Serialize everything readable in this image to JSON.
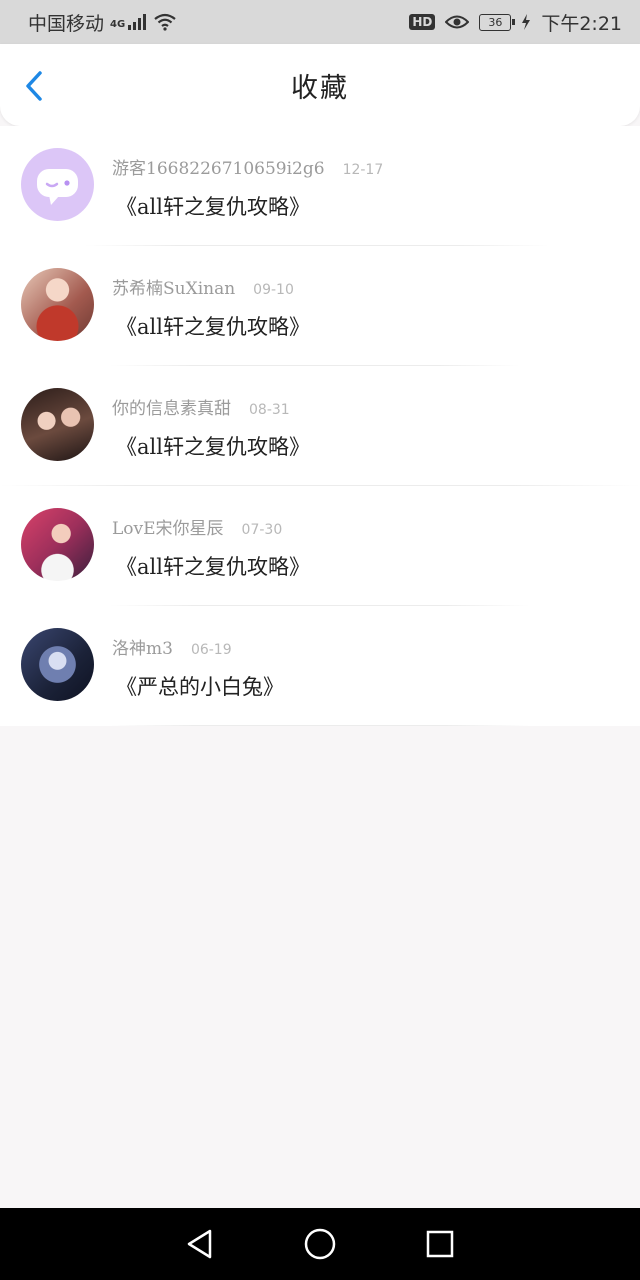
{
  "status_bar": {
    "carrier": "中国移动",
    "network": "4G",
    "hd_label": "HD",
    "battery": "36",
    "time": "下午2:21"
  },
  "header": {
    "title": "收藏"
  },
  "favorites": [
    {
      "username": "游客1668226710659i2g6",
      "date": "12-17",
      "title": "《all轩之复仇攻略》",
      "avatar_icon": "chat-bubble-icon"
    },
    {
      "username": "苏希楠SuXinan",
      "date": "09-10",
      "title": "《all轩之复仇攻略》",
      "avatar_icon": "user-photo"
    },
    {
      "username": "你的信息素真甜",
      "date": "08-31",
      "title": "《all轩之复仇攻略》",
      "avatar_icon": "user-photo"
    },
    {
      "username": "LovE宋你星辰",
      "date": "07-30",
      "title": "《all轩之复仇攻略》",
      "avatar_icon": "user-photo"
    },
    {
      "username": "洛神m3",
      "date": "06-19",
      "title": "《严总的小白兔》",
      "avatar_icon": "user-photo"
    }
  ],
  "colors": {
    "accent": "#1e88e5",
    "background": "#f8f6f7",
    "muted_text": "#9b9b9b"
  }
}
